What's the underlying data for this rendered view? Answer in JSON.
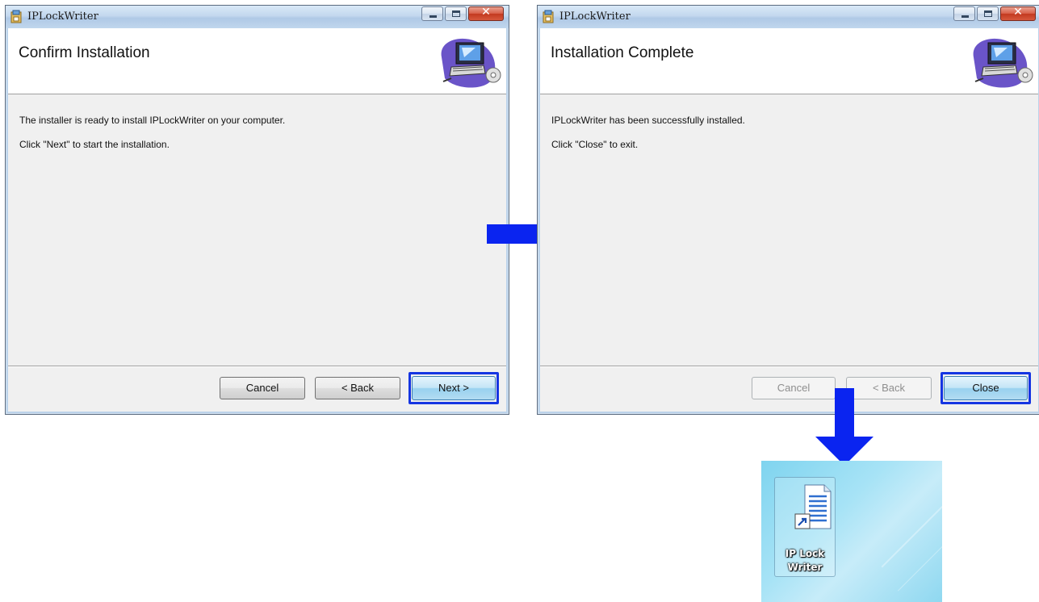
{
  "left_window": {
    "title": "IPLockWriter",
    "heading": "Confirm Installation",
    "line1": "The installer is ready to install IPLockWriter on your computer.",
    "line2": "Click \"Next\" to start the installation.",
    "buttons": {
      "cancel": "Cancel",
      "back": "< Back",
      "next": "Next >"
    }
  },
  "right_window": {
    "title": "IPLockWriter",
    "heading": "Installation Complete",
    "line1": "IPLockWriter has been successfully installed.",
    "line2": "Click \"Close\" to exit.",
    "buttons": {
      "cancel": "Cancel",
      "back": "< Back",
      "close": "Close"
    }
  },
  "desktop_shortcut": {
    "label_line1": "IP Lock",
    "label_line2": "Writer"
  },
  "colors": {
    "highlight": "#1535e2",
    "arrow": "#0a24f0",
    "desktop": "#8fd8f0"
  },
  "icons": [
    "installer-app-icon",
    "computer-disk-banner-icon",
    "document-shortcut-icon"
  ]
}
